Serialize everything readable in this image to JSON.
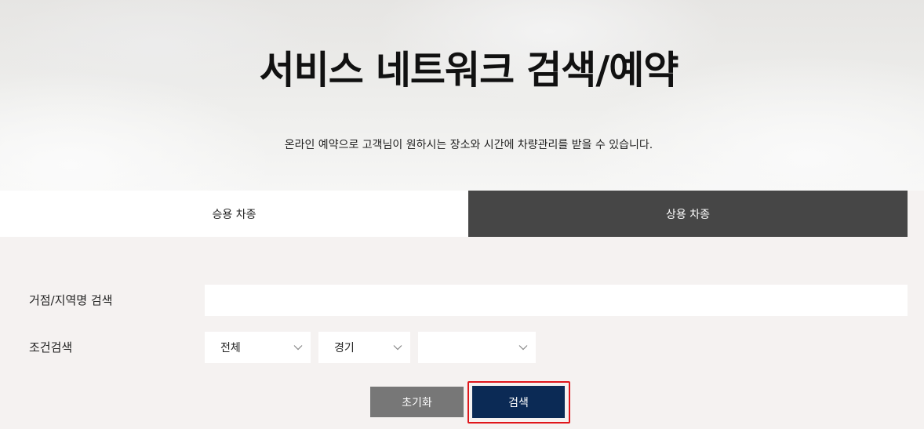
{
  "hero": {
    "title": "서비스 네트워크 검색/예약",
    "subtitle": "온라인 예약으로 고객님이 원하시는 장소와 시간에 차량관리를 받을 수 있습니다."
  },
  "tabs": [
    {
      "label": "승용 차종",
      "active": false
    },
    {
      "label": "상용 차종",
      "active": true
    }
  ],
  "form": {
    "location_label": "거점/지역명 검색",
    "location_value": "",
    "condition_label": "조건검색",
    "selects": [
      {
        "value": "전체"
      },
      {
        "value": "경기"
      },
      {
        "value": ""
      }
    ]
  },
  "buttons": {
    "reset_label": "초기화",
    "search_label": "검색"
  },
  "colors": {
    "active_tab": "#464646",
    "search_button": "#0b2a55",
    "reset_button": "#777777",
    "highlight": "#e0161b"
  }
}
